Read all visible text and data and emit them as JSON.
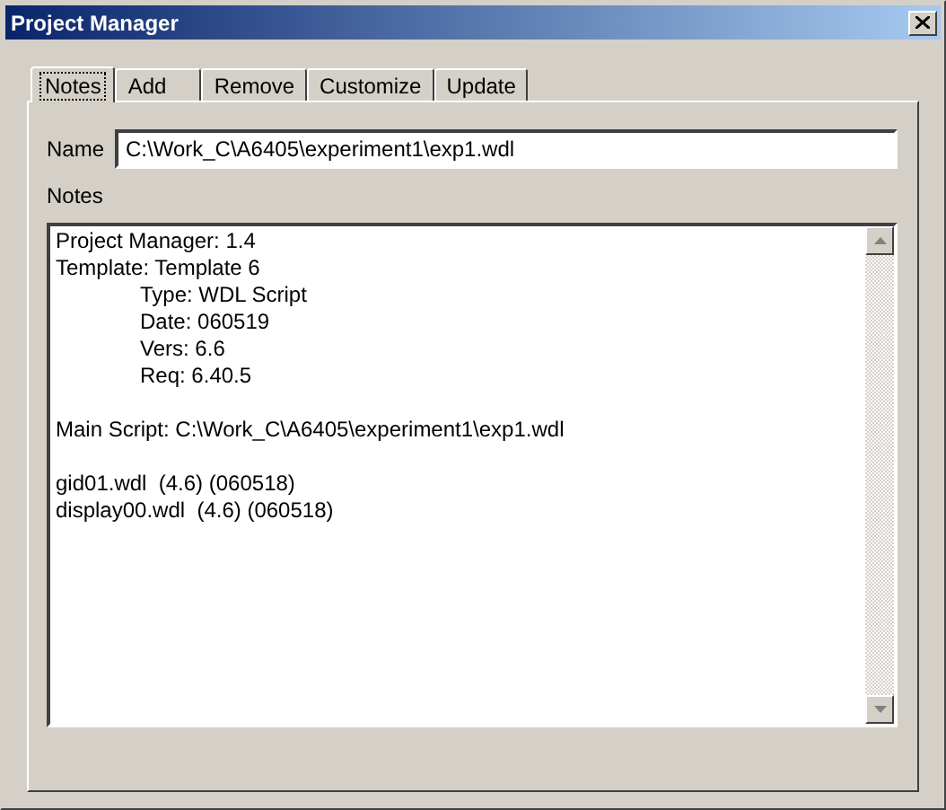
{
  "window": {
    "title": "Project Manager"
  },
  "tabs": [
    {
      "label": "Notes",
      "selected": true
    },
    {
      "label": "Add",
      "selected": false
    },
    {
      "label": "Remove",
      "selected": false
    },
    {
      "label": "Customize",
      "selected": false
    },
    {
      "label": "Update",
      "selected": false
    }
  ],
  "name_field": {
    "label": "Name",
    "value": "C:\\Work_C\\A6405\\experiment1\\exp1.wdl"
  },
  "notes": {
    "label": "Notes",
    "paragraphs": [
      {
        "lines": [
          {
            "text": "Project Manager: 1.4"
          },
          {
            "text": "Template: Template 6",
            "children": [
              {
                "text": "Type: WDL Script"
              },
              {
                "text": "Date: 060519"
              },
              {
                "text": "Vers: 6.6"
              },
              {
                "text": "Req: 6.40.5"
              }
            ]
          }
        ]
      },
      {
        "lines": [
          {
            "text": "Main Script: C:\\Work_C\\A6405\\experiment1\\exp1.wdl"
          }
        ]
      },
      {
        "lines": [
          {
            "text": "gid01.wdl  (4.6) (060518)"
          },
          {
            "text": "display00.wdl  (4.6) (060518)"
          }
        ]
      }
    ]
  }
}
